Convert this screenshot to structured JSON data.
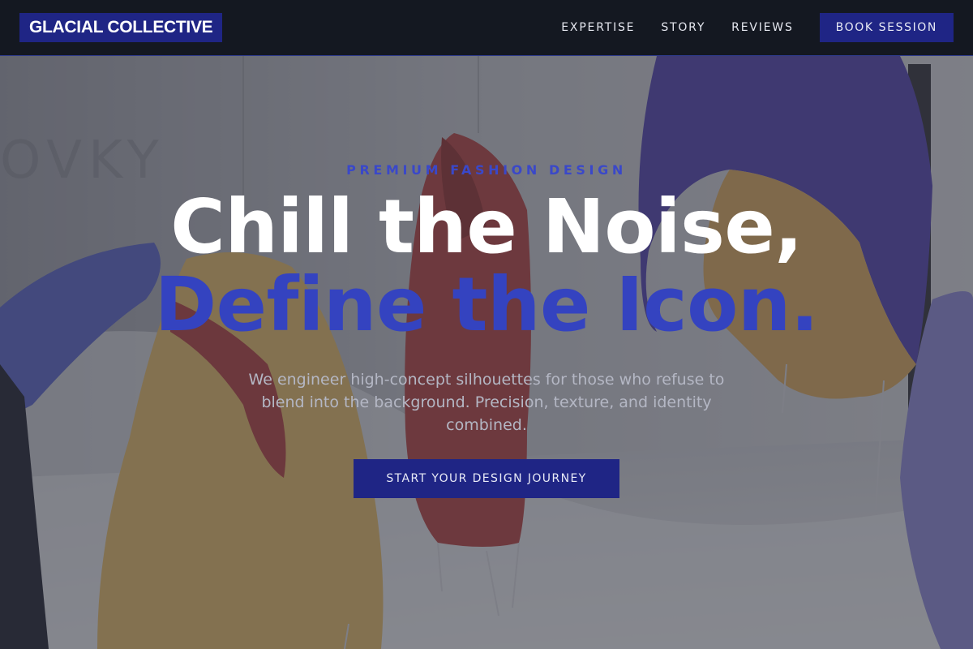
{
  "brand": {
    "name": "GLACIAL COLLECTIVE",
    "accent": "#1f2585"
  },
  "nav": {
    "links": [
      "EXPERTISE",
      "STORY",
      "REVIEWS"
    ],
    "cta_label": "BOOK SESSION"
  },
  "hero": {
    "eyebrow": "PREMIUM FASHION DESIGN",
    "headline_line1": "Chill the Noise,",
    "headline_line2": "Define the Icon.",
    "subtext": "We engineer high-concept silhouettes for those who refuse to blend into the background. Precision, texture, and identity combined.",
    "cta_label": "START YOUR DESIGN JOURNEY",
    "background_image": "garments-hanging-gallery",
    "headline_accent": "#3443c0"
  }
}
